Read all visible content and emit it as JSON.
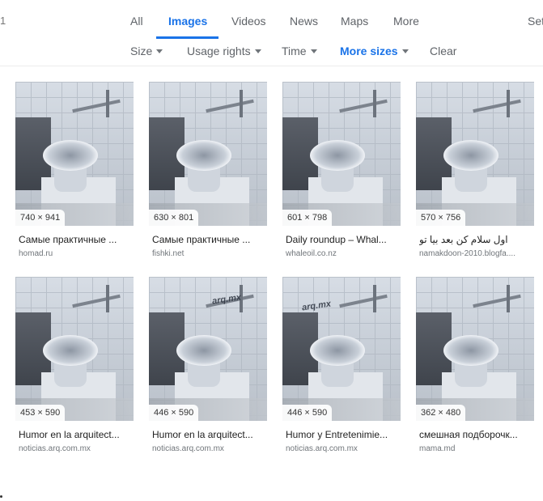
{
  "header": {
    "left_edge_text": "1",
    "right_edge_text": "Settings",
    "tabs": [
      {
        "label": "All",
        "active": false
      },
      {
        "label": "Images",
        "active": true
      },
      {
        "label": "Videos",
        "active": false
      },
      {
        "label": "News",
        "active": false
      },
      {
        "label": "Maps",
        "active": false
      },
      {
        "label": "More",
        "active": false
      }
    ],
    "tools": [
      {
        "label": "Size",
        "caret": true,
        "active": false
      },
      {
        "label": "Usage rights",
        "caret": true,
        "active": false
      },
      {
        "label": "Time",
        "caret": true,
        "active": false
      },
      {
        "label": "More sizes",
        "caret": true,
        "active": true
      },
      {
        "label": "Clear",
        "caret": false,
        "active": false
      }
    ],
    "accent_color": "#1a73e8"
  },
  "results": [
    {
      "dims": "740 × 941",
      "title": "Самые практичные ...",
      "site": "homad.ru",
      "watermark": ""
    },
    {
      "dims": "630 × 801",
      "title": "Самые практичные ...",
      "site": "fishki.net",
      "watermark": ""
    },
    {
      "dims": "601 × 798",
      "title": "Daily roundup – Whal...",
      "site": "whaleoil.co.nz",
      "watermark": ""
    },
    {
      "dims": "570 × 756",
      "title": "اول سلام کن بعد بیا تو",
      "site": "namakdoon-2010.blogfa....",
      "watermark": ""
    },
    {
      "dims": "453 × 590",
      "title": "Humor en la arquitect...",
      "site": "noticias.arq.com.mx",
      "watermark": ""
    },
    {
      "dims": "446 × 590",
      "title": "Humor en la arquitect...",
      "site": "noticias.arq.com.mx",
      "watermark": "arq.mx"
    },
    {
      "dims": "446 × 590",
      "title": "Humor y Entretenimie...",
      "site": "noticias.arq.com.mx",
      "watermark": "arq.mx"
    },
    {
      "dims": "362 × 480",
      "title": "смешная подборочк...",
      "site": "mama.md",
      "watermark": ""
    }
  ]
}
